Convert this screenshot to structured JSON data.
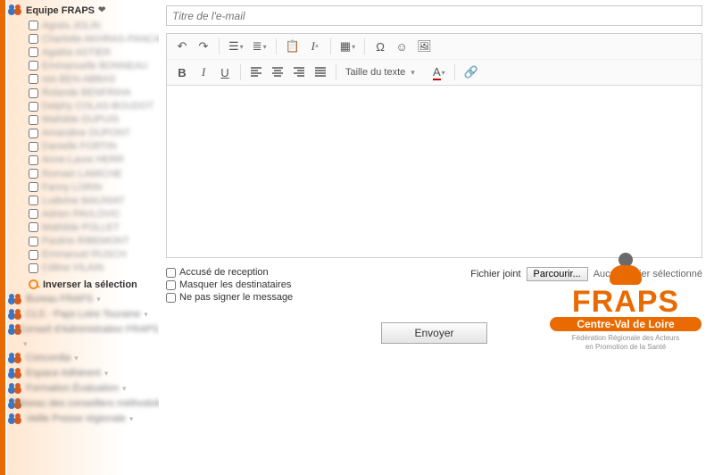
{
  "sidebar": {
    "activeGroup": {
      "name": "Equipe FRAPS",
      "members": [
        "Agnès JOLIN",
        "Charlotte AKHRAS-PANCALDI",
        "Agathe ASTIER",
        "Emmanuelle BONNEAU",
        "Isis BEN-ABBAS",
        "Rolande BENFRIHA",
        "Delphy COLAS-BOUDOT",
        "Mathilde DUPUIS",
        "Amandine DUPONT",
        "Danielle FORTIN",
        "Anne-Laure HERR",
        "Romain LAMICHE",
        "Fanny LORIN",
        "Ludivine MAUNIAT",
        "Adrien PAVLOVIC",
        "Mathilde POLLET",
        "Pauline RIBEMONT",
        "Emmanuel RUSCH",
        "Céline VILAIN"
      ],
      "invertLabel": "Inverser la sélection"
    },
    "otherGroups": [
      "Bureau FRAPS",
      "CLS - Pays Loire Touraine",
      "Conseil d'Administration FRAPS",
      "Concordia",
      "Espace Adhérent",
      "Formation Évaluation",
      "Réseau des conseillers méthodologiques",
      "Veille Presse régionale"
    ]
  },
  "compose": {
    "subjectPlaceholder": "Titre de l'e-mail",
    "fontSizeLabel": "Taille du texte",
    "options": {
      "receipt": "Accusé de reception",
      "hideRecipients": "Masquer les destinataires",
      "noSign": "Ne pas signer le message"
    },
    "attachmentLabel": "Fichier joint",
    "browseButton": "Parcourir...",
    "noFileSelected": "Aucun fichier sélectionné",
    "sendButton": "Envoyer"
  },
  "branding": {
    "name": "FRAPS",
    "region": "Centre-Val de Loire",
    "tagline1": "Fédération Régionale des Acteurs",
    "tagline2": "en Promotion de la Santé"
  }
}
